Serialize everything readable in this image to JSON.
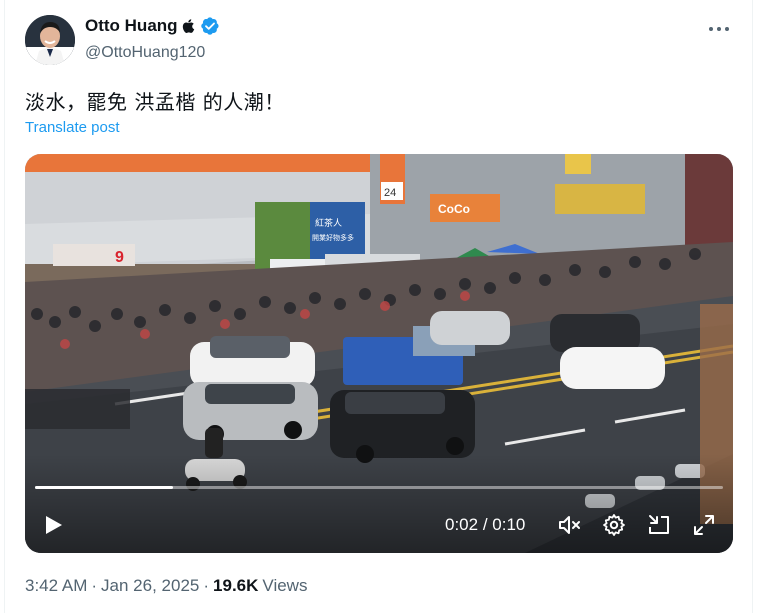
{
  "author": {
    "display_name": "Otto Huang",
    "handle": "@OttoHuang120",
    "badge_icon": "apple-icon",
    "verified_icon": "verified-badge-icon"
  },
  "tweet": {
    "text": "淡水，罷免 洪孟楷 的人潮！",
    "translate_label": "Translate post"
  },
  "video": {
    "current_time": "0:02",
    "separator": "/",
    "duration": "0:10",
    "progress": 0.2,
    "scene_signs": {
      "left_sign": "9",
      "corner_sign": "24",
      "store_sign": "CoCo",
      "banner_title": "紅茶人",
      "banner_sub": "開業好物多多"
    }
  },
  "meta": {
    "time": "3:42 AM",
    "dot": "·",
    "date": "Jan 26, 2025",
    "views_count": "19.6K",
    "views_label": "Views"
  },
  "colors": {
    "link": "#1d9bf0",
    "muted": "#536471",
    "verified": "#1d9bf0"
  }
}
